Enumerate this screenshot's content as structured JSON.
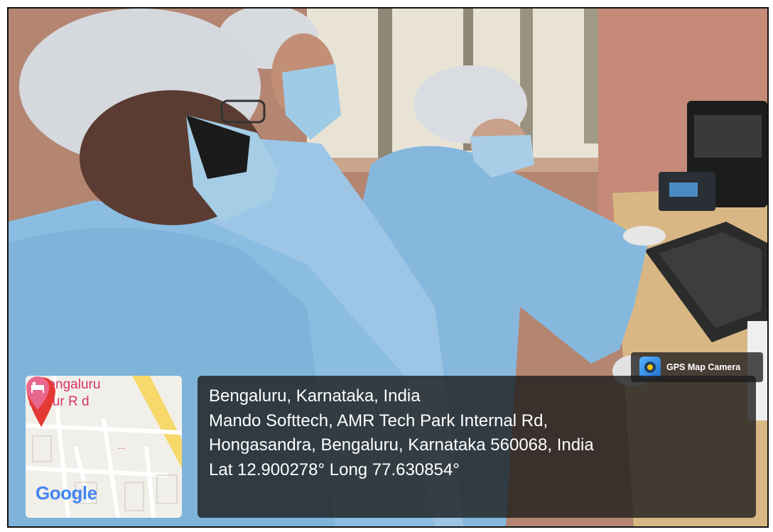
{
  "overlay": {
    "app_label": "GPS Map Camera",
    "app_icon": "gps-map-camera-icon",
    "map": {
      "label_line1": "s Bengaluru",
      "label_line2": "Hosur R   d",
      "label_line3": "...",
      "provider": "Google",
      "pin_icon": "location-pin-icon",
      "poi_icon": "hotel-bed-icon"
    },
    "address": {
      "line1": "Bengaluru, Karnataka, India",
      "line2": "Mando Softtech, AMR Tech Park Internal Rd,",
      "line3": "Hongasandra, Bengaluru, Karnataka 560068, India",
      "line4": "Lat 12.900278° Long 77.630854°"
    }
  },
  "colors": {
    "wall": "#b88b78",
    "gown": "#8fbfe0",
    "desk": "#d9b785",
    "map_label": "#d6336c",
    "pin_red": "#e53935",
    "panel_bg": "rgba(28,28,28,0.80)"
  }
}
